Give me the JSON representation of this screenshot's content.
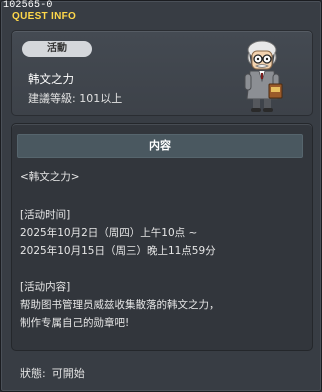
{
  "window": {
    "quest_id": "102565-0",
    "title": "QUEST INFO"
  },
  "header": {
    "badge": "活動",
    "quest_name": "韩文之力",
    "recommended_level": "建議等級: 101以上",
    "npc_icon": "librarian-npc-icon"
  },
  "content": {
    "section_title": "内容",
    "lines": [
      "<韩文之力>",
      "",
      "[活动时间]",
      "2025年10月2日（周四）上午10点 ~",
      "2025年10月15日（周三）晚上11点59分",
      "",
      "[活动内容]",
      "帮助图书管理员威兹收集散落的韩文之力，",
      "制作专属自己的勋章吧!"
    ]
  },
  "status": {
    "label": "狀態:",
    "value": "可開始"
  },
  "colors": {
    "title": "#ffd84a",
    "badge_bg": "#d4d7db",
    "section_header_bg": "#4a5860"
  }
}
